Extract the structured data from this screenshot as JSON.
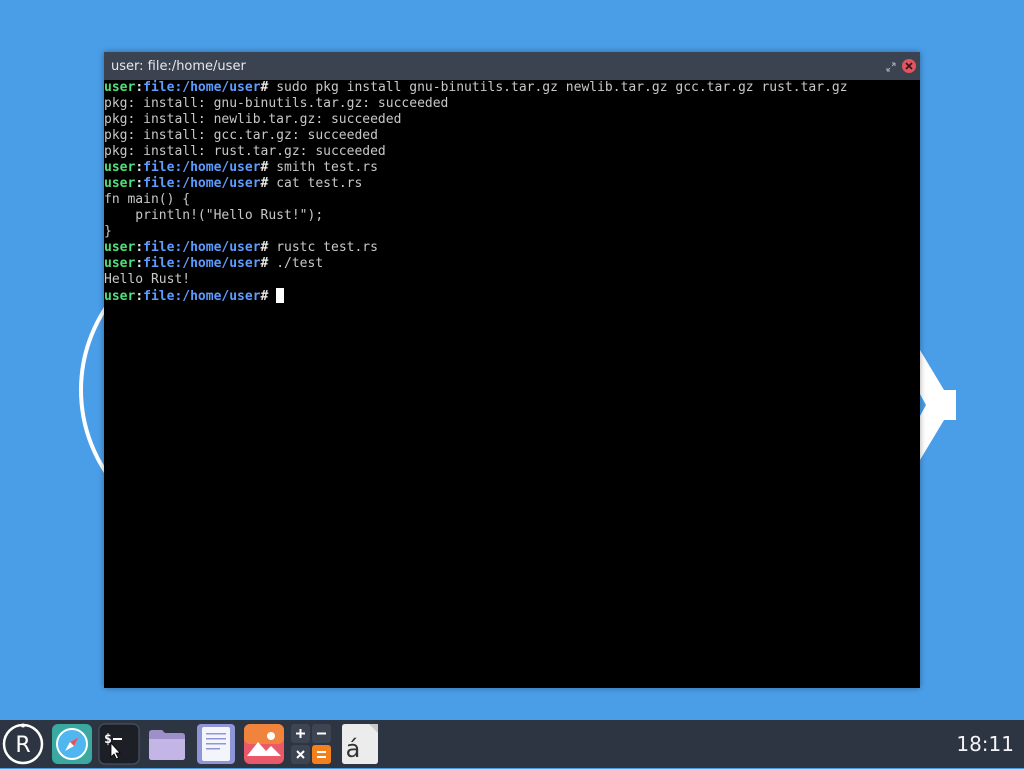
{
  "window": {
    "title": "user: file:/home/user"
  },
  "terminal": {
    "prompt": {
      "user": "user",
      "sep": ":",
      "path": "file:/home/user",
      "hash": "# "
    },
    "lines": [
      {
        "type": "prompt",
        "text": "sudo pkg install gnu-binutils.tar.gz newlib.tar.gz gcc.tar.gz rust.tar.gz"
      },
      {
        "type": "output",
        "text": "pkg: install: gnu-binutils.tar.gz: succeeded"
      },
      {
        "type": "output",
        "text": "pkg: install: newlib.tar.gz: succeeded"
      },
      {
        "type": "output",
        "text": "pkg: install: gcc.tar.gz: succeeded"
      },
      {
        "type": "output",
        "text": "pkg: install: rust.tar.gz: succeeded"
      },
      {
        "type": "prompt",
        "text": "smith test.rs"
      },
      {
        "type": "prompt",
        "text": "cat test.rs"
      },
      {
        "type": "output",
        "text": "fn main() {"
      },
      {
        "type": "output",
        "text": "    println!(\"Hello Rust!\");"
      },
      {
        "type": "output",
        "text": "}"
      },
      {
        "type": "prompt",
        "text": "rustc test.rs"
      },
      {
        "type": "prompt",
        "text": "./test"
      },
      {
        "type": "output",
        "text": "Hello Rust!"
      },
      {
        "type": "prompt",
        "text": "",
        "cursor": true
      }
    ]
  },
  "taskbar": {
    "apps": [
      {
        "name": "launcher-icon"
      },
      {
        "name": "browser-icon"
      },
      {
        "name": "terminal-icon",
        "glyph": "$_"
      },
      {
        "name": "file-manager-icon"
      },
      {
        "name": "text-editor-icon"
      },
      {
        "name": "image-viewer-icon"
      },
      {
        "name": "calculator-icon"
      },
      {
        "name": "character-map-icon",
        "glyph": "á"
      }
    ],
    "clock": "18:11"
  },
  "colors": {
    "desktop": "#4a9ee8",
    "taskbar": "#2e3542",
    "titlebar": "#3b4350",
    "prompt_user": "#4fe07a",
    "prompt_path": "#5d9cff",
    "output_text": "#c8c8c8"
  }
}
